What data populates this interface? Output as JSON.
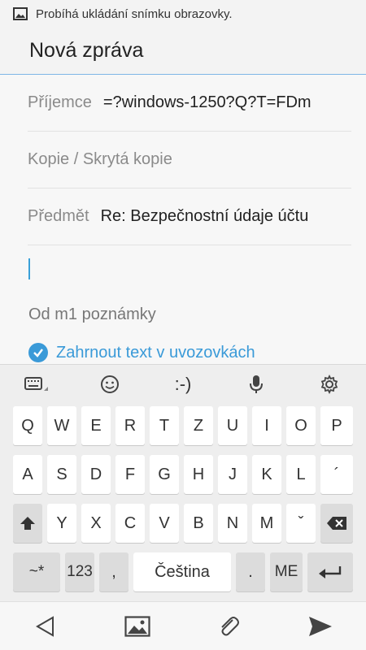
{
  "status_bar": {
    "text": "Probíhá ukládání snímku obrazovky."
  },
  "app_bar": {
    "title": "Nová zpráva"
  },
  "compose": {
    "recipient_label": "Příjemce",
    "recipient_value": "=?windows-1250?Q?T=FDm",
    "cc_bcc_placeholder": "Kopie / Skrytá kopie",
    "subject_label": "Předmět",
    "subject_value": "Re: Bezpečnostní údaje účtu",
    "signature": "Od m1 poznámky",
    "include_quoted_text": "Zahrnout text v uvozovkách",
    "include_quoted_checked": true
  },
  "keyboard": {
    "toolbar": {
      "emoticon_text": ":-)"
    },
    "row1": [
      "Q",
      "W",
      "E",
      "R",
      "T",
      "Z",
      "U",
      "I",
      "O",
      "P"
    ],
    "row2": [
      "A",
      "S",
      "D",
      "F",
      "G",
      "H",
      "J",
      "K",
      "L",
      "´"
    ],
    "row3": [
      "Y",
      "X",
      "C",
      "V",
      "B",
      "N",
      "M",
      "ˇ"
    ],
    "row4": {
      "symbols": "~*",
      "numbers": "123",
      "comma": ",",
      "space": "Čeština",
      "period": ".",
      "me": "ME"
    }
  },
  "colors": {
    "accent": "#3a9ad8"
  }
}
